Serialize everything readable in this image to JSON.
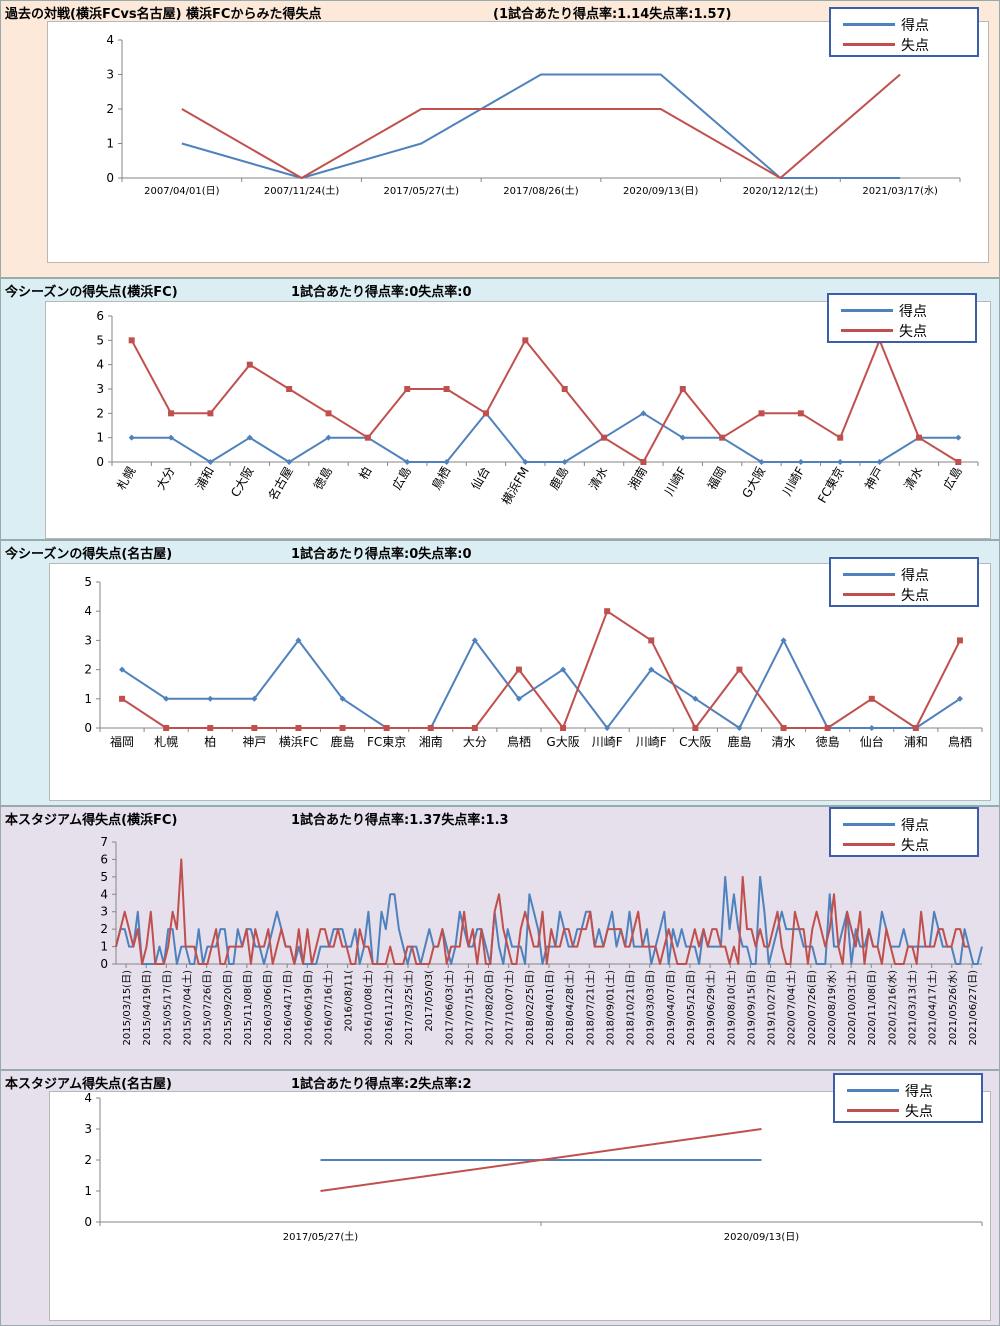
{
  "colors": {
    "score": "#4f81bd",
    "concede": "#c0504d"
  },
  "sections": [
    {
      "title": "過去の対戦(横浜FCvs名古屋)  横浜FCからみた得失点",
      "rate": "(1試合あたり得点率:1.14失点率:1.57)",
      "bg": "#fde9d9"
    },
    {
      "title": "今シーズンの得失点(横浜FC)",
      "rate": "1試合あたり得点率:0失点率:0",
      "bg": "#daeef3"
    },
    {
      "title": "今シーズンの得失点(名古屋)",
      "rate": "1試合あたり得点率:0失点率:0",
      "bg": "#daeef3"
    },
    {
      "title": "本スタジアム得失点(横浜FC)",
      "rate": "1試合あたり得点率:1.37失点率:1.3",
      "bg": "#e5e0ec"
    },
    {
      "title": "本スタジアム得失点(名古屋)",
      "rate": "1試合あたり得点率:2失点率:2",
      "bg": "#e5e0ec"
    }
  ],
  "chart_data": [
    {
      "type": "line",
      "categories": [
        "2007/04/01(日)",
        "2007/11/24(土)",
        "2017/05/27(土)",
        "2017/08/26(土)",
        "2020/09/13(日)",
        "2020/12/12(土)",
        "2021/03/17(水)"
      ],
      "series": [
        {
          "name": "得点",
          "values": [
            1,
            0,
            1,
            3,
            3,
            0,
            0
          ]
        },
        {
          "name": "失点",
          "values": [
            2,
            0,
            2,
            2,
            2,
            0,
            3
          ]
        }
      ],
      "ylim": [
        0,
        4
      ],
      "legend": "top-right",
      "grid": false
    },
    {
      "type": "line",
      "categories": [
        "札幌",
        "大分",
        "浦和",
        "C大阪",
        "名古屋",
        "徳島",
        "柏",
        "広島",
        "鳥栖",
        "仙台",
        "横浜FM",
        "鹿島",
        "清水",
        "湘南",
        "川崎F",
        "福岡",
        "G大阪",
        "川崎F",
        "FC東京",
        "神戸",
        "清水",
        "広島"
      ],
      "series": [
        {
          "name": "得点",
          "values": [
            1,
            1,
            0,
            1,
            0,
            1,
            1,
            0,
            0,
            2,
            0,
            0,
            1,
            2,
            1,
            1,
            0,
            0,
            0,
            0,
            1,
            1
          ]
        },
        {
          "name": "失点",
          "values": [
            5,
            2,
            2,
            4,
            3,
            2,
            1,
            3,
            3,
            2,
            5,
            3,
            1,
            0,
            3,
            1,
            2,
            2,
            1,
            5,
            1,
            0
          ]
        }
      ],
      "ylim": [
        0,
        6
      ],
      "legend": "top-right",
      "grid": false
    },
    {
      "type": "line",
      "categories": [
        "福岡",
        "札幌",
        "柏",
        "神戸",
        "横浜FC",
        "鹿島",
        "FC東京",
        "湘南",
        "大分",
        "鳥栖",
        "G大阪",
        "川崎F",
        "川崎F",
        "C大阪",
        "鹿島",
        "清水",
        "徳島",
        "仙台",
        "浦和",
        "鳥栖"
      ],
      "series": [
        {
          "name": "得点",
          "values": [
            2,
            1,
            1,
            1,
            3,
            1,
            0,
            0,
            3,
            1,
            2,
            0,
            2,
            1,
            0,
            3,
            0,
            0,
            0,
            1
          ]
        },
        {
          "name": "失点",
          "values": [
            1,
            0,
            0,
            0,
            0,
            0,
            0,
            0,
            0,
            2,
            0,
            4,
            3,
            0,
            2,
            0,
            0,
            1,
            0,
            3
          ]
        }
      ],
      "ylim": [
        0,
        5
      ],
      "legend": "top-right",
      "grid": false
    },
    {
      "type": "line",
      "categories": [
        "2015/03/15(日)",
        "2015/04/19(日)",
        "2015/05/17(日)",
        "2015/07/04(土)",
        "2015/07/26(日)",
        "2015/09/20(日)",
        "2015/11/08(日)",
        "2016/03/06(日)",
        "2016/04/17(日)",
        "2016/06/19(日)",
        "2016/07/16(土)",
        "2016/08/11(",
        "2016/10/08(土)",
        "2016/11/12(土)",
        "2017/03/25(土)",
        "2017/05/03(",
        "2017/06/03(土)",
        "2017/07/15(土)",
        "2017/08/20(日)",
        "2017/10/07(土)",
        "2018/02/25(日)",
        "2018/04/01(日)",
        "2018/04/28(土)",
        "2018/07/21(土)",
        "2018/09/01(土)",
        "2018/10/21(日)",
        "2019/03/03(日)",
        "2019/04/07(日)",
        "2019/05/12(日)",
        "2019/06/29(土)",
        "2019/08/10(土)",
        "2019/09/15(日)",
        "2019/10/27(日)",
        "2020/07/04(土)",
        "2020/07/26(日)",
        "2020/08/19(水)",
        "2020/10/03(土)",
        "2020/11/08(日)",
        "2020/12/16(水)",
        "2021/03/13(土)",
        "2021/04/17(土)",
        "2021/05/26(水)",
        "2021/06/27(日)"
      ],
      "series": [
        {
          "name": "得点",
          "values": [
            1,
            2,
            2,
            1,
            1,
            3,
            0,
            0,
            0,
            0,
            1,
            0,
            2,
            2,
            0,
            1,
            1,
            0,
            0,
            2,
            0,
            1,
            1,
            1,
            2,
            2,
            0,
            0,
            2,
            1,
            2,
            2,
            1,
            1,
            0,
            1,
            2,
            3,
            2,
            1,
            1,
            0,
            1,
            0,
            0,
            0,
            0,
            1,
            1,
            1,
            2,
            2,
            2,
            1,
            1,
            2,
            0,
            1,
            3,
            0,
            0,
            3,
            2,
            4,
            4,
            2,
            1,
            0,
            1,
            1,
            0,
            1,
            2,
            1,
            1,
            2,
            1,
            0,
            1,
            3,
            2,
            1,
            1,
            2,
            2,
            1,
            0,
            3,
            1,
            0,
            2,
            1,
            1,
            1,
            0,
            4,
            3,
            2,
            0,
            1,
            1,
            1,
            3,
            2,
            1,
            1,
            2,
            2,
            3,
            3,
            1,
            2,
            1,
            2,
            3,
            1,
            2,
            1,
            3,
            1,
            1,
            1,
            2,
            0,
            1,
            2,
            3,
            0,
            2,
            1,
            2,
            1,
            1,
            1,
            0,
            2,
            1,
            1,
            1,
            1,
            5,
            2,
            4,
            2,
            1,
            1,
            0,
            0,
            5,
            3,
            0,
            1,
            2,
            3,
            2,
            2,
            2,
            2,
            1,
            1,
            1,
            0,
            0,
            0,
            4,
            1,
            1,
            2,
            3,
            0,
            2,
            1,
            1,
            2,
            1,
            1,
            3,
            2,
            1,
            1,
            1,
            2,
            1,
            1,
            1,
            1,
            1,
            1,
            3,
            2,
            1,
            1,
            1,
            0,
            0,
            2,
            1,
            0,
            0,
            1
          ]
        },
        {
          "name": "失点",
          "values": [
            1,
            2,
            3,
            2,
            1,
            2,
            0,
            1,
            3,
            0,
            0,
            0,
            1,
            3,
            2,
            6,
            1,
            1,
            1,
            0,
            0,
            0,
            1,
            2,
            0,
            0,
            1,
            1,
            1,
            1,
            2,
            0,
            2,
            1,
            1,
            2,
            0,
            1,
            2,
            1,
            1,
            0,
            2,
            0,
            2,
            0,
            1,
            2,
            2,
            1,
            1,
            2,
            1,
            1,
            0,
            0,
            2,
            1,
            1,
            0,
            0,
            0,
            0,
            1,
            0,
            0,
            0,
            1,
            1,
            0,
            0,
            0,
            0,
            1,
            1,
            2,
            0,
            1,
            1,
            1,
            3,
            1,
            2,
            0,
            2,
            0,
            0,
            3,
            4,
            2,
            1,
            0,
            0,
            2,
            3,
            2,
            1,
            1,
            3,
            0,
            2,
            1,
            1,
            2,
            2,
            1,
            1,
            2,
            2,
            3,
            1,
            1,
            1,
            2,
            2,
            2,
            2,
            1,
            1,
            2,
            3,
            1,
            1,
            1,
            1,
            0,
            1,
            2,
            1,
            0,
            0,
            0,
            1,
            2,
            1,
            2,
            1,
            2,
            2,
            1,
            1,
            0,
            1,
            0,
            5,
            2,
            2,
            1,
            2,
            1,
            1,
            2,
            3,
            1,
            0,
            0,
            3,
            2,
            2,
            0,
            2,
            3,
            2,
            1,
            2,
            4,
            1,
            0,
            3,
            2,
            1,
            3,
            0,
            2,
            1,
            1,
            0,
            2,
            1,
            0,
            0,
            0,
            1,
            1,
            0,
            3,
            1,
            1,
            1,
            2,
            2,
            1,
            1,
            2,
            2,
            1,
            1
          ]
        }
      ],
      "ylim": [
        0,
        7
      ],
      "legend": "top-right",
      "grid": false
    },
    {
      "type": "line",
      "categories": [
        "2017/05/27(土)",
        "2020/09/13(日)"
      ],
      "series": [
        {
          "name": "得点",
          "values": [
            2,
            2
          ]
        },
        {
          "name": "失点",
          "values": [
            1,
            3
          ]
        }
      ],
      "ylim": [
        0,
        4
      ],
      "legend": "top-right",
      "grid": false
    }
  ]
}
